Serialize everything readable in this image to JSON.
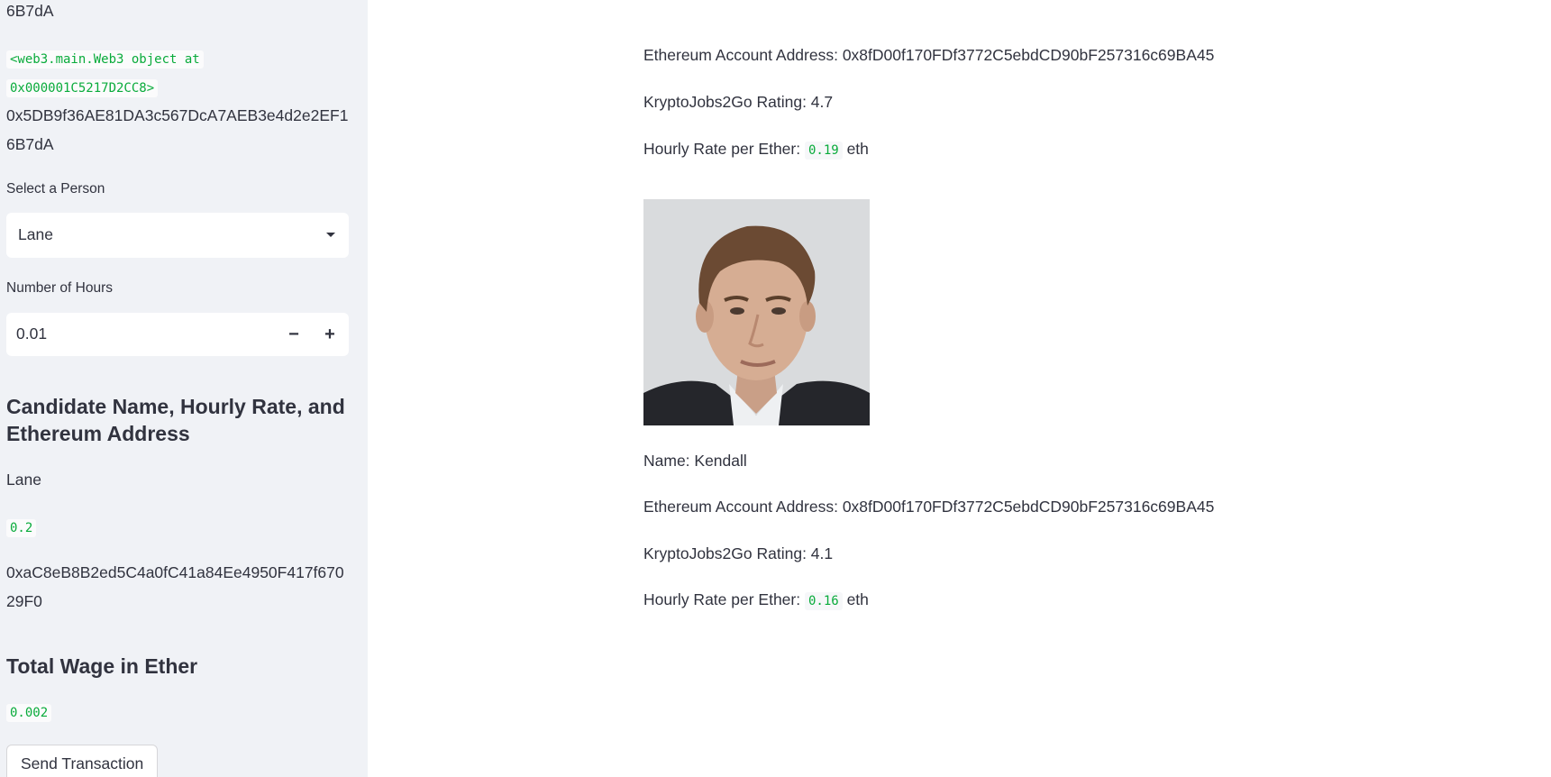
{
  "sidebar": {
    "top_address_tail": "6B7dA",
    "web3_object_line1": "<web3.main.Web3 object at",
    "web3_object_line2": "0x000001C5217D2CC8>",
    "account_address_line1": "0x5DB9f36AE81DA3c567DcA7AEB3e4d2e2EF1",
    "account_address_line2": "6B7dA",
    "select_person_label": "Select a Person",
    "select_person_value": "Lane",
    "hours_label": "Number of Hours",
    "hours_value": "0.01",
    "hours_minus": "−",
    "hours_plus": "+",
    "candidate_heading": "Candidate Name, Hourly Rate, and Ethereum Address",
    "candidate_name": "Lane",
    "candidate_rate": "0.2",
    "candidate_address_line1": "0xaC8eB8B2ed5C4a0fC41a84Ee4950F417f670",
    "candidate_address_line2": "29F0",
    "total_wage_heading": "Total Wage in Ether",
    "total_wage_value": "0.002",
    "send_button": "Send Transaction"
  },
  "main": {
    "card1": {
      "address_label": "Ethereum Account Address: 0x8fD00f170FDf3772C5ebdCD90bF257316c69BA45",
      "rating_label": "KryptoJobs2Go Rating: 4.7",
      "rate_prefix": "Hourly Rate per Ether:",
      "rate_value": "0.19",
      "rate_suffix": "eth"
    },
    "card2": {
      "name_label": "Name: Kendall",
      "address_label": "Ethereum Account Address: 0x8fD00f170FDf3772C5ebdCD90bF257316c69BA45",
      "rating_label": "KryptoJobs2Go Rating: 4.1",
      "rate_prefix": "Hourly Rate per Ether:",
      "rate_value": "0.16",
      "rate_suffix": "eth"
    }
  },
  "colors": {
    "sidebar_bg": "#f0f2f6",
    "code_text": "#09ab3b",
    "text": "#31333f"
  }
}
